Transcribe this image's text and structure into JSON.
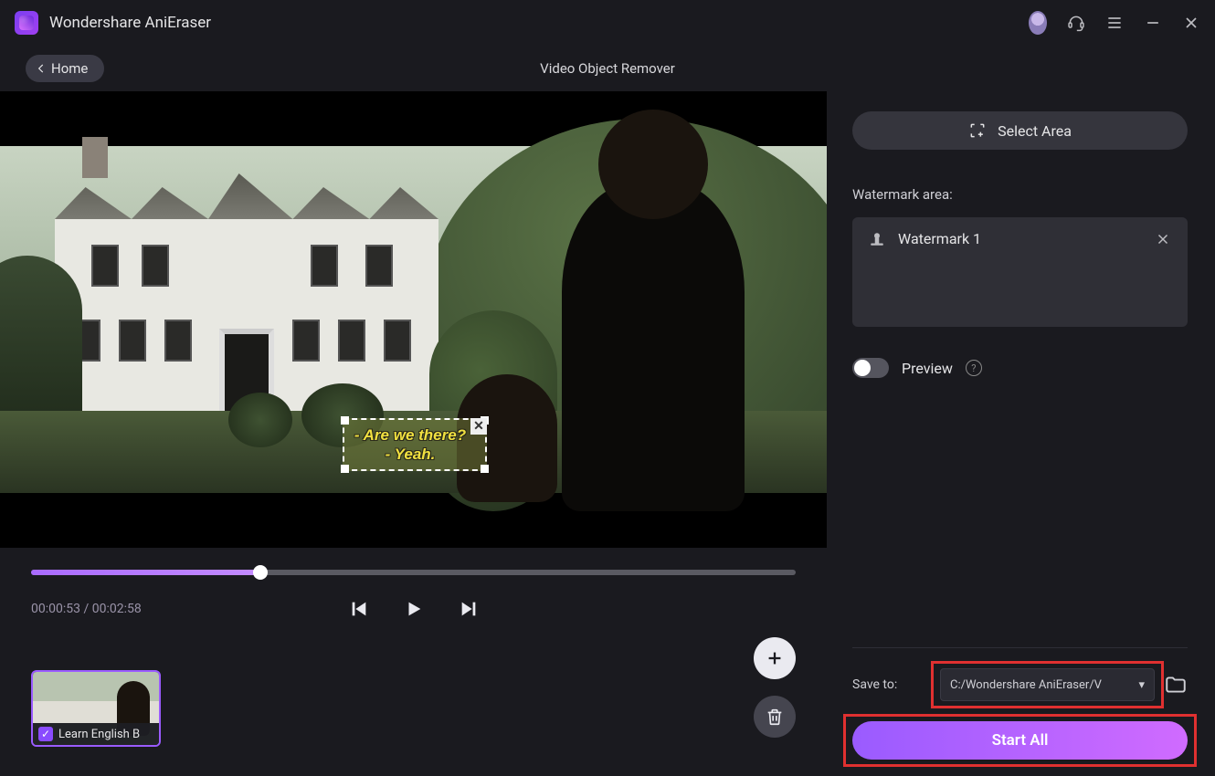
{
  "app": {
    "title": "Wondershare AniEraser"
  },
  "header": {
    "home_label": "Home",
    "page_title": "Video Object Remover"
  },
  "video": {
    "subtitle_line1": "- Are we there?",
    "subtitle_line2": "- Yeah."
  },
  "timeline": {
    "current": "00:00:53",
    "total": "00:02:58",
    "progress_pct": 30
  },
  "clip": {
    "filename": "Learn English B"
  },
  "panel": {
    "select_area_label": "Select Area",
    "watermark_section": "Watermark area:",
    "watermarks": [
      {
        "name": "Watermark 1"
      }
    ],
    "preview_label": "Preview",
    "save_label": "Save to:",
    "save_path": "C:/Wondershare AniEraser/V",
    "start_label": "Start All"
  },
  "icons": {
    "select_area": "selection-icon",
    "watermark": "watermark-stamp-icon"
  }
}
